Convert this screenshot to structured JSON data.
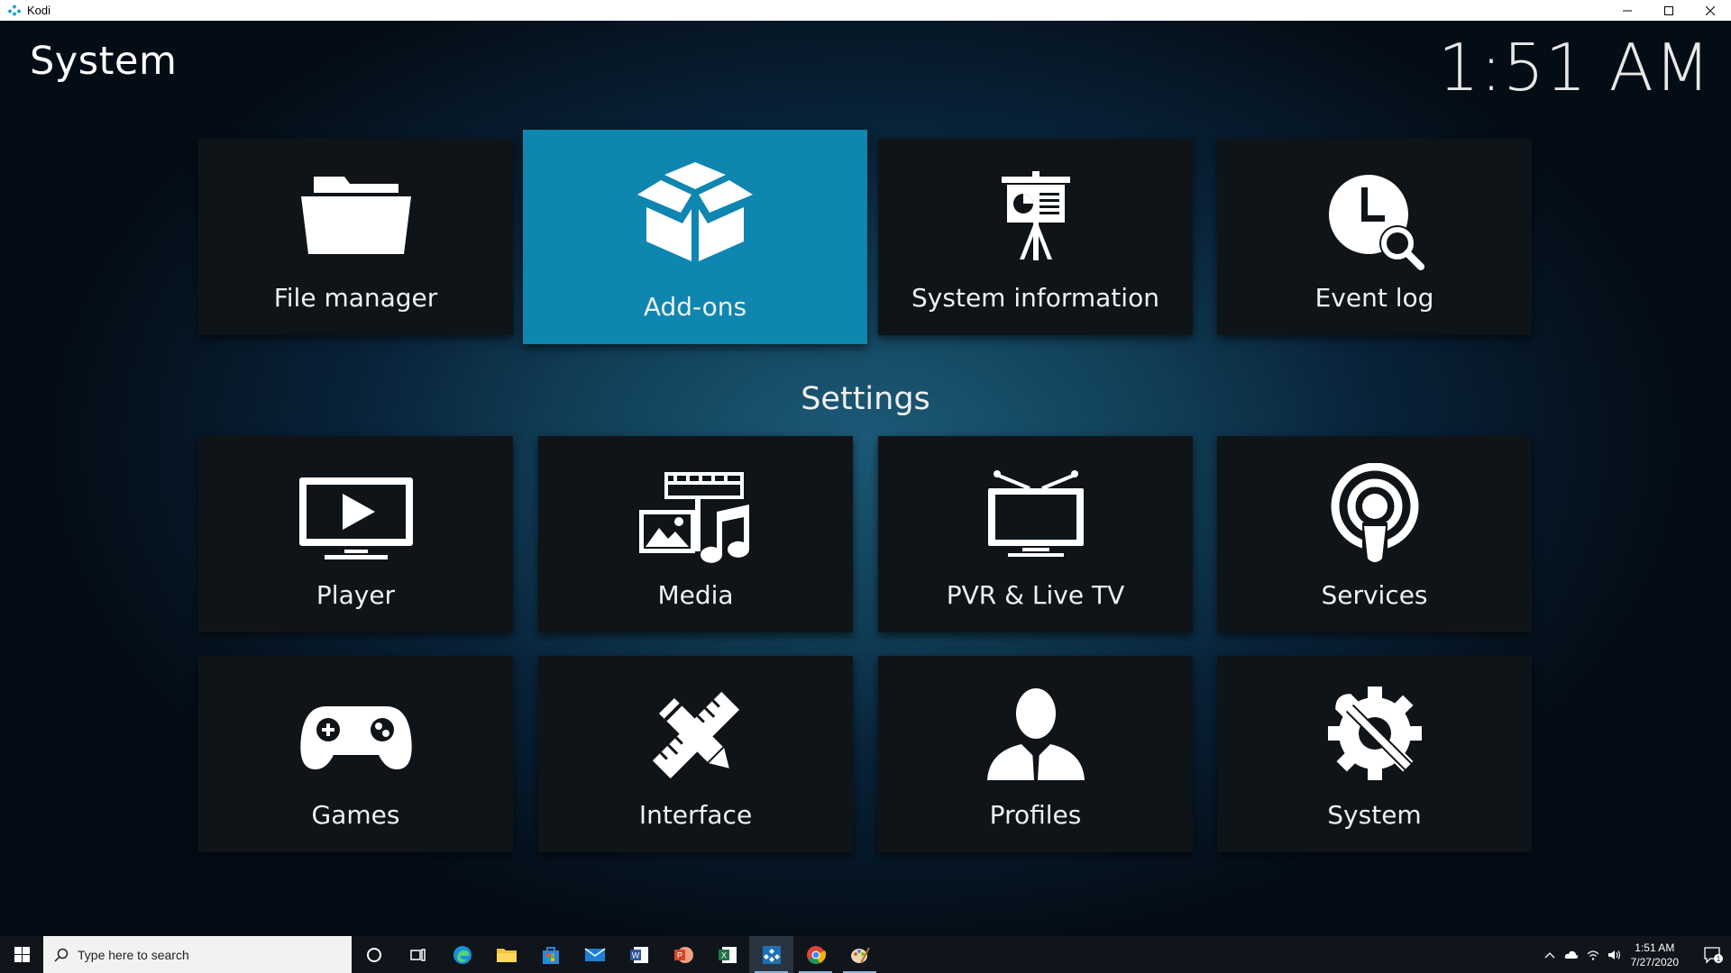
{
  "window": {
    "title": "Kodi",
    "minimize": "–",
    "maximize": "□",
    "close": "✕"
  },
  "header": {
    "page_title": "System",
    "clock": "1:51 AM"
  },
  "top_tiles": [
    {
      "label": "File manager",
      "icon": "folder-icon"
    },
    {
      "label": "Add-ons",
      "icon": "open-box-icon",
      "active": true
    },
    {
      "label": "System information",
      "icon": "presentation-board-icon"
    },
    {
      "label": "Event log",
      "icon": "clock-search-icon"
    }
  ],
  "settings": {
    "title": "Settings",
    "tiles": [
      {
        "label": "Player",
        "icon": "monitor-play-icon"
      },
      {
        "label": "Media",
        "icon": "media-collage-icon"
      },
      {
        "label": "PVR & Live TV",
        "icon": "tv-icon"
      },
      {
        "label": "Services",
        "icon": "broadcast-icon"
      },
      {
        "label": "Games",
        "icon": "gamepad-icon"
      },
      {
        "label": "Interface",
        "icon": "pencil-ruler-icon"
      },
      {
        "label": "Profiles",
        "icon": "person-icon"
      },
      {
        "label": "System",
        "icon": "gear-wrench-icon"
      }
    ]
  },
  "taskbar": {
    "search_placeholder": "Type here to search",
    "apps": [
      "cortana-icon",
      "task-view-icon",
      "edge-icon",
      "file-explorer-icon",
      "store-icon",
      "mail-icon",
      "word-icon",
      "powerpoint-icon",
      "excel-icon",
      "kodi-taskbar-icon",
      "chrome-icon",
      "paint-icon"
    ],
    "tray_time": "1:51 AM",
    "tray_date": "7/27/2020",
    "notification_count": "1"
  },
  "colors": {
    "accent": "#0e86b0",
    "tile": "#0f1418"
  }
}
